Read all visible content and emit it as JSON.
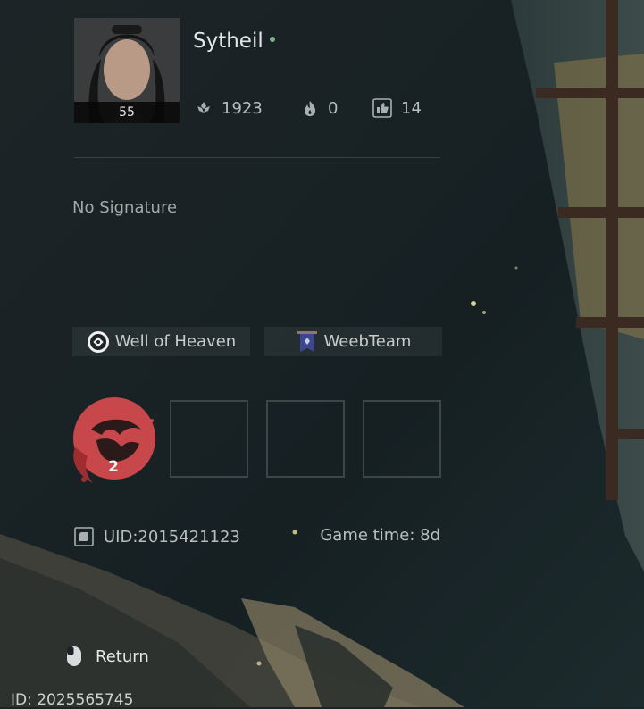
{
  "profile": {
    "name": "Sytheil",
    "level": "55",
    "online_color": "#7fb08f"
  },
  "stats": [
    {
      "icon": "lotus-icon",
      "value": "1923"
    },
    {
      "icon": "flame-icon",
      "value": "0"
    },
    {
      "icon": "thumbs-up-icon",
      "value": "14"
    }
  ],
  "signature": "No Signature",
  "tags": [
    {
      "icon": "sect-emblem-icon",
      "label": "Well of Heaven"
    },
    {
      "icon": "guild-banner-icon",
      "label": "WeebTeam"
    }
  ],
  "badges": {
    "main_badge": {
      "icon": "red-medallion-icon",
      "count": "2"
    },
    "empty_slots": 3
  },
  "info": {
    "uid": "UID:2015421123",
    "game_time": "Game time: 8d"
  },
  "footer": {
    "return_label": "Return",
    "id_text": "ID: 2025565745"
  },
  "colors": {
    "background": "#1a2326",
    "badge_red": "#c8474a",
    "window_wood": "#3a2a22"
  }
}
